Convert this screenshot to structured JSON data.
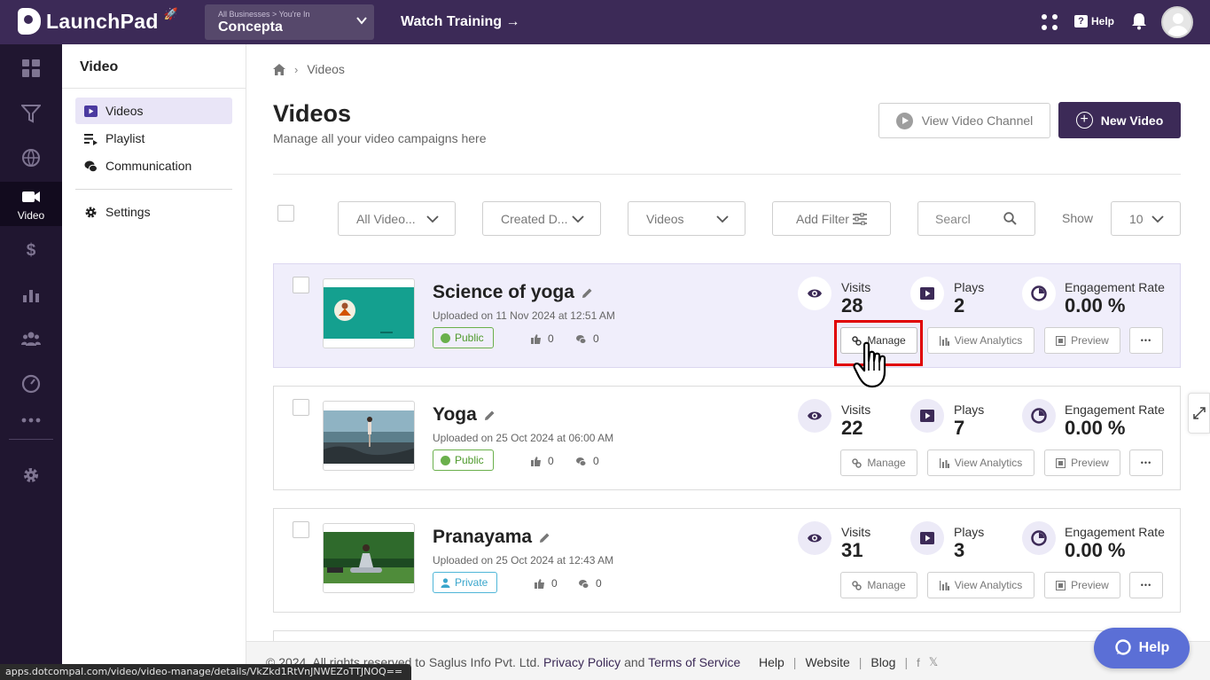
{
  "topbar": {
    "app_name": "LaunchPad",
    "business_crumb": "All Businesses  >  You're In",
    "business_name": "Concepta",
    "watch_training": "Watch Training →",
    "help_label": "Help"
  },
  "rail": {
    "active_label": "Video"
  },
  "subnav": {
    "title": "Video",
    "items": [
      {
        "label": "Videos",
        "icon": "play-square-icon"
      },
      {
        "label": "Playlist",
        "icon": "playlist-icon"
      },
      {
        "label": "Communication",
        "icon": "chat-icon"
      }
    ],
    "settings_label": "Settings"
  },
  "breadcrumb": {
    "current": "Videos"
  },
  "page": {
    "title": "Videos",
    "subtitle": "Manage all your video campaigns here",
    "view_channel_label": "View Video Channel",
    "new_video_label": "New Video"
  },
  "filters": {
    "all_videos": "All Video...",
    "created_date": "Created D...",
    "videos": "Videos",
    "add_filter": "Add Filter",
    "search_placeholder": "Searcl",
    "show_label": "Show",
    "show_value": "10"
  },
  "labels": {
    "visits": "Visits",
    "plays": "Plays",
    "engagement": "Engagement Rate",
    "manage": "Manage",
    "view_analytics": "View Analytics",
    "preview": "Preview",
    "more": "•••"
  },
  "videos": [
    {
      "title": "Science of yoga",
      "uploaded": "Uploaded on 11 Nov 2024 at 12:51 AM",
      "visibility": "Public",
      "likes": "0",
      "comments": "0",
      "visits": "28",
      "plays": "2",
      "engagement": "0.00 %"
    },
    {
      "title": "Yoga",
      "uploaded": "Uploaded on 25 Oct 2024 at 06:00 AM",
      "visibility": "Public",
      "likes": "0",
      "comments": "0",
      "visits": "22",
      "plays": "7",
      "engagement": "0.00 %"
    },
    {
      "title": "Pranayama",
      "uploaded": "Uploaded on 25 Oct 2024 at 12:43 AM",
      "visibility": "Private",
      "likes": "0",
      "comments": "0",
      "visits": "31",
      "plays": "3",
      "engagement": "0.00 %"
    }
  ],
  "footer": {
    "copyright": "©  2024. All rights reserved to Saglus Info Pvt. Ltd.",
    "privacy": "Privacy Policy",
    "and": "and",
    "terms": "Terms of Service",
    "help": "Help",
    "website": "Website",
    "blog": "Blog",
    "social_f": "f",
    "social_x": "𝕏"
  },
  "help_fab": "Help",
  "status_url": "apps.dotcompal.com/video/video-manage/details/VkZkd1RtVnJNWEZoTTJNOQ==",
  "colors": {
    "brand": "#3c2a57",
    "rail": "#201630",
    "highlight": "#f0eefb",
    "public": "#4e9a2c",
    "private": "#3aa6cc",
    "help_fab": "#5b6fd6",
    "focus_box": "#e00000"
  }
}
